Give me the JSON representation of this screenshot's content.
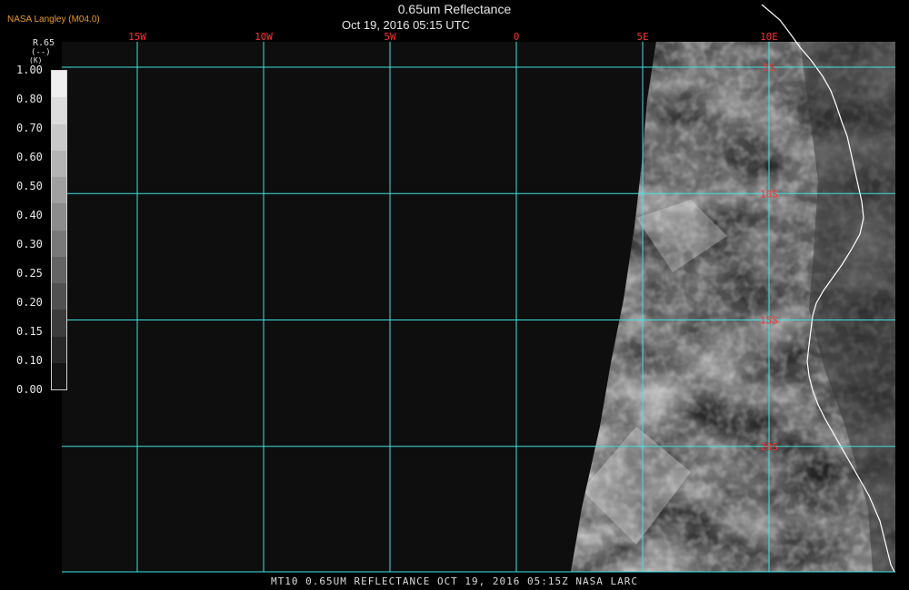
{
  "header": {
    "brand": "NASA Langley (M04.0)",
    "title": "0.65um Reflectance",
    "datetime": "Oct 19, 2016 05:15 UTC"
  },
  "footer": "MT10  0.65UM REFLECTANCE  OCT 19, 2016 05:15Z  NASA LARC",
  "legend": {
    "name": "R.65",
    "unit": "(--)",
    "k": "(K)",
    "ticks": [
      "1.00",
      "0.80",
      "0.70",
      "0.60",
      "0.50",
      "0.40",
      "0.30",
      "0.25",
      "0.20",
      "0.15",
      "0.10",
      "0.00"
    ],
    "colors": [
      "#f0f0f0",
      "#dcdcdc",
      "#c8c8c8",
      "#b4b4b4",
      "#a0a0a0",
      "#8c8c8c",
      "#787878",
      "#646464",
      "#505050",
      "#3c3c3c",
      "#282828",
      "#141414"
    ]
  },
  "map": {
    "longitudes": [
      {
        "label": "15W",
        "value": -15
      },
      {
        "label": "10W",
        "value": -10
      },
      {
        "label": "5W",
        "value": -5
      },
      {
        "label": "0",
        "value": 0
      },
      {
        "label": "5E",
        "value": 5
      },
      {
        "label": "10E",
        "value": 10
      }
    ],
    "latitudes": [
      {
        "label": "5S",
        "value": -5
      },
      {
        "label": "10S",
        "value": -10
      },
      {
        "label": "15S",
        "value": -15
      },
      {
        "label": "20S",
        "value": -20
      }
    ],
    "colors": {
      "grid": "#40e0e0",
      "grid_label": "#ff3030",
      "coastline": "#ffffff",
      "space": "#0e0e0e"
    }
  }
}
